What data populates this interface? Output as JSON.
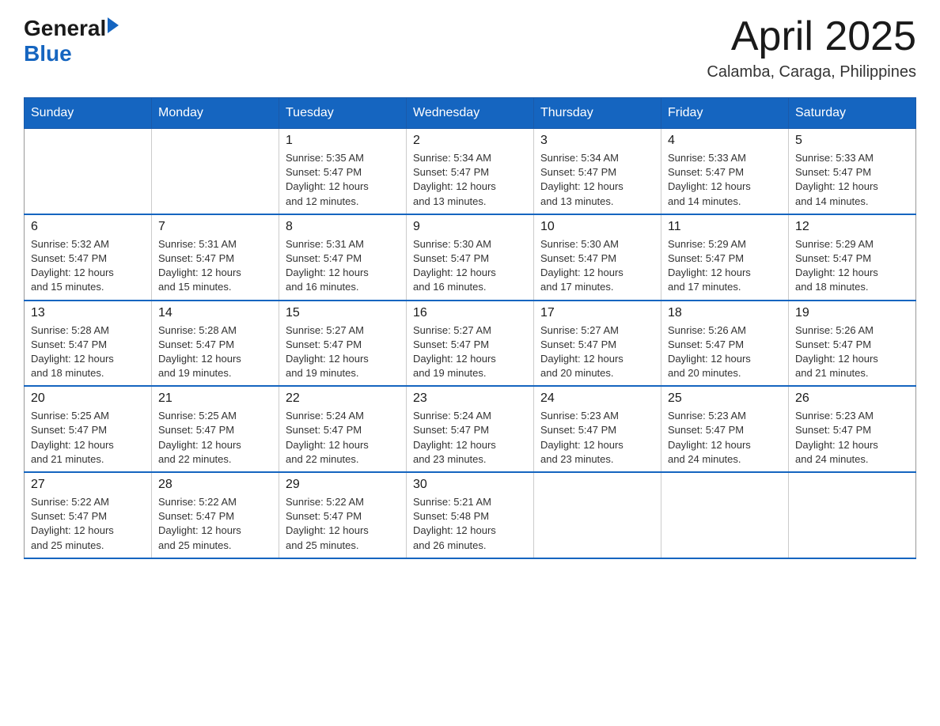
{
  "logo": {
    "general": "General",
    "blue": "Blue"
  },
  "title": "April 2025",
  "location": "Calamba, Caraga, Philippines",
  "days_header": [
    "Sunday",
    "Monday",
    "Tuesday",
    "Wednesday",
    "Thursday",
    "Friday",
    "Saturday"
  ],
  "weeks": [
    [
      {
        "day": "",
        "info": ""
      },
      {
        "day": "",
        "info": ""
      },
      {
        "day": "1",
        "info": "Sunrise: 5:35 AM\nSunset: 5:47 PM\nDaylight: 12 hours\nand 12 minutes."
      },
      {
        "day": "2",
        "info": "Sunrise: 5:34 AM\nSunset: 5:47 PM\nDaylight: 12 hours\nand 13 minutes."
      },
      {
        "day": "3",
        "info": "Sunrise: 5:34 AM\nSunset: 5:47 PM\nDaylight: 12 hours\nand 13 minutes."
      },
      {
        "day": "4",
        "info": "Sunrise: 5:33 AM\nSunset: 5:47 PM\nDaylight: 12 hours\nand 14 minutes."
      },
      {
        "day": "5",
        "info": "Sunrise: 5:33 AM\nSunset: 5:47 PM\nDaylight: 12 hours\nand 14 minutes."
      }
    ],
    [
      {
        "day": "6",
        "info": "Sunrise: 5:32 AM\nSunset: 5:47 PM\nDaylight: 12 hours\nand 15 minutes."
      },
      {
        "day": "7",
        "info": "Sunrise: 5:31 AM\nSunset: 5:47 PM\nDaylight: 12 hours\nand 15 minutes."
      },
      {
        "day": "8",
        "info": "Sunrise: 5:31 AM\nSunset: 5:47 PM\nDaylight: 12 hours\nand 16 minutes."
      },
      {
        "day": "9",
        "info": "Sunrise: 5:30 AM\nSunset: 5:47 PM\nDaylight: 12 hours\nand 16 minutes."
      },
      {
        "day": "10",
        "info": "Sunrise: 5:30 AM\nSunset: 5:47 PM\nDaylight: 12 hours\nand 17 minutes."
      },
      {
        "day": "11",
        "info": "Sunrise: 5:29 AM\nSunset: 5:47 PM\nDaylight: 12 hours\nand 17 minutes."
      },
      {
        "day": "12",
        "info": "Sunrise: 5:29 AM\nSunset: 5:47 PM\nDaylight: 12 hours\nand 18 minutes."
      }
    ],
    [
      {
        "day": "13",
        "info": "Sunrise: 5:28 AM\nSunset: 5:47 PM\nDaylight: 12 hours\nand 18 minutes."
      },
      {
        "day": "14",
        "info": "Sunrise: 5:28 AM\nSunset: 5:47 PM\nDaylight: 12 hours\nand 19 minutes."
      },
      {
        "day": "15",
        "info": "Sunrise: 5:27 AM\nSunset: 5:47 PM\nDaylight: 12 hours\nand 19 minutes."
      },
      {
        "day": "16",
        "info": "Sunrise: 5:27 AM\nSunset: 5:47 PM\nDaylight: 12 hours\nand 19 minutes."
      },
      {
        "day": "17",
        "info": "Sunrise: 5:27 AM\nSunset: 5:47 PM\nDaylight: 12 hours\nand 20 minutes."
      },
      {
        "day": "18",
        "info": "Sunrise: 5:26 AM\nSunset: 5:47 PM\nDaylight: 12 hours\nand 20 minutes."
      },
      {
        "day": "19",
        "info": "Sunrise: 5:26 AM\nSunset: 5:47 PM\nDaylight: 12 hours\nand 21 minutes."
      }
    ],
    [
      {
        "day": "20",
        "info": "Sunrise: 5:25 AM\nSunset: 5:47 PM\nDaylight: 12 hours\nand 21 minutes."
      },
      {
        "day": "21",
        "info": "Sunrise: 5:25 AM\nSunset: 5:47 PM\nDaylight: 12 hours\nand 22 minutes."
      },
      {
        "day": "22",
        "info": "Sunrise: 5:24 AM\nSunset: 5:47 PM\nDaylight: 12 hours\nand 22 minutes."
      },
      {
        "day": "23",
        "info": "Sunrise: 5:24 AM\nSunset: 5:47 PM\nDaylight: 12 hours\nand 23 minutes."
      },
      {
        "day": "24",
        "info": "Sunrise: 5:23 AM\nSunset: 5:47 PM\nDaylight: 12 hours\nand 23 minutes."
      },
      {
        "day": "25",
        "info": "Sunrise: 5:23 AM\nSunset: 5:47 PM\nDaylight: 12 hours\nand 24 minutes."
      },
      {
        "day": "26",
        "info": "Sunrise: 5:23 AM\nSunset: 5:47 PM\nDaylight: 12 hours\nand 24 minutes."
      }
    ],
    [
      {
        "day": "27",
        "info": "Sunrise: 5:22 AM\nSunset: 5:47 PM\nDaylight: 12 hours\nand 25 minutes."
      },
      {
        "day": "28",
        "info": "Sunrise: 5:22 AM\nSunset: 5:47 PM\nDaylight: 12 hours\nand 25 minutes."
      },
      {
        "day": "29",
        "info": "Sunrise: 5:22 AM\nSunset: 5:47 PM\nDaylight: 12 hours\nand 25 minutes."
      },
      {
        "day": "30",
        "info": "Sunrise: 5:21 AM\nSunset: 5:48 PM\nDaylight: 12 hours\nand 26 minutes."
      },
      {
        "day": "",
        "info": ""
      },
      {
        "day": "",
        "info": ""
      },
      {
        "day": "",
        "info": ""
      }
    ]
  ]
}
